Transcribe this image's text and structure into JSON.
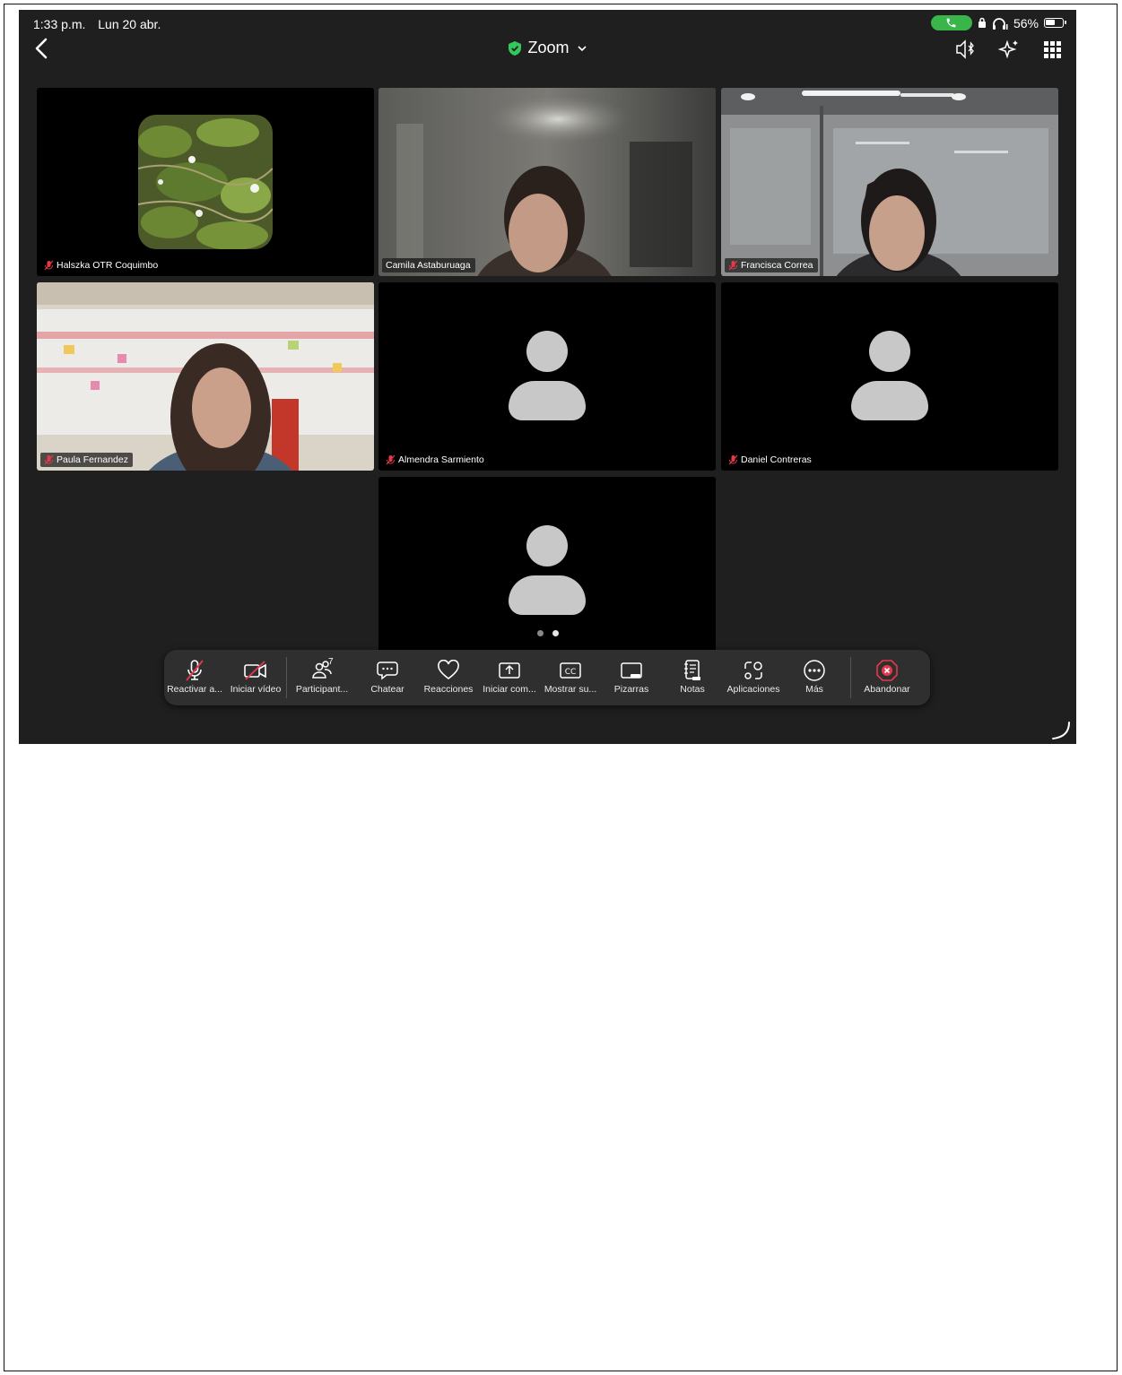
{
  "status_bar": {
    "time": "1:33 p.m.",
    "date": "Lun 20 abr.",
    "battery_percent": "56%",
    "battery_level": 0.56,
    "call_color": "#3ab54a"
  },
  "header": {
    "title": "Zoom",
    "shield_color": "#34c759"
  },
  "participants": [
    {
      "name": "Halszka OTR Coquimbo",
      "muted": true,
      "active": false,
      "video": "image"
    },
    {
      "name": "Camila Astaburuaga",
      "muted": false,
      "active": true,
      "video": "camera"
    },
    {
      "name": "Francisca Correa",
      "muted": true,
      "active": false,
      "video": "camera"
    },
    {
      "name": "Paula Fernandez",
      "muted": true,
      "active": false,
      "video": "camera"
    },
    {
      "name": "Almendra Sarmiento",
      "muted": true,
      "active": false,
      "video": "avatar"
    },
    {
      "name": "Daniel Contreras",
      "muted": true,
      "active": false,
      "video": "avatar"
    }
  ],
  "pagination": {
    "pages": 2,
    "current": 2
  },
  "toolbar": {
    "unmute": "Reactivar a...",
    "start_video": "Iniciar vídeo",
    "participants": "Participant...",
    "participants_count": "7",
    "chat": "Chatear",
    "reactions": "Reacciones",
    "share": "Iniciar com...",
    "captions": "Mostrar su...",
    "whiteboards": "Pizarras",
    "notes": "Notas",
    "apps": "Aplicaciones",
    "more": "Más",
    "leave": "Abandonar",
    "leave_color": "#e5384b"
  }
}
